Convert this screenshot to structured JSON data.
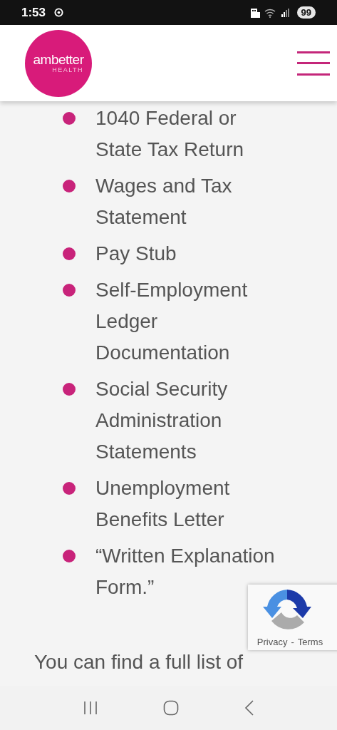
{
  "status_bar": {
    "time": "1:53",
    "battery": "99"
  },
  "header": {
    "logo": {
      "name": "ambetter",
      "sub": "HEALTH"
    }
  },
  "documents": [
    {
      "lines": [
        "1040 Federal or",
        "State Tax Return"
      ]
    },
    {
      "lines": [
        "Wages and Tax",
        "Statement"
      ]
    },
    {
      "lines": [
        "Pay Stub"
      ]
    },
    {
      "lines": [
        "Self-Employment",
        "Ledger",
        "Documentation"
      ]
    },
    {
      "lines": [
        "Social Security",
        "Administration",
        "Statements"
      ]
    },
    {
      "lines": [
        "Unemployment",
        "Benefits Letter"
      ]
    },
    {
      "lines": [
        "“Written Explanation",
        "Form.”"
      ]
    }
  ],
  "paragraph": "You can find a full list of",
  "recaptcha": {
    "privacy": "Privacy",
    "separator": "-",
    "terms": "Terms"
  }
}
